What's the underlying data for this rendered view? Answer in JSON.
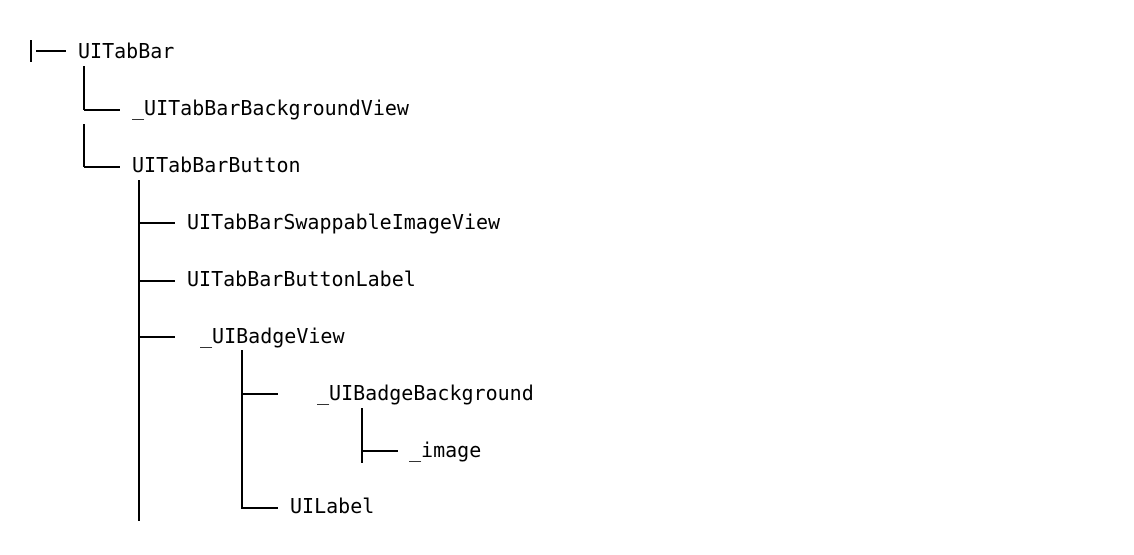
{
  "diagram": {
    "root_prefix": "|——",
    "nodes": {
      "tabbar": "UITabBar",
      "background_view": "_UITabBarBackgroundView",
      "tabbar_button": "UITabBarButton",
      "swappable_image_view": "UITabBarSwappableImageView",
      "button_label": "UITabBarButtonLabel",
      "badge_view": "_UIBadgeView",
      "badge_background": "_UIBadgeBackground",
      "image": "_image",
      "label": "UILabel"
    }
  }
}
